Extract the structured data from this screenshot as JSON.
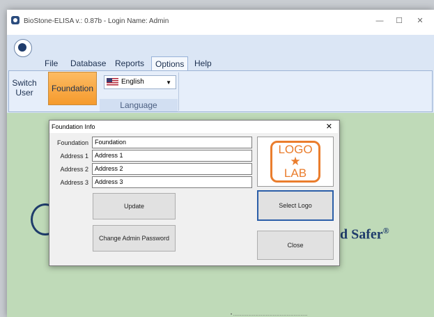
{
  "window": {
    "title": "BioStone-ELISA v.: 0.87b - Login Name: Admin",
    "controls": {
      "minimize": "—",
      "maximize": "☐",
      "close": "✕"
    }
  },
  "ribbon": {
    "tabs": [
      "File",
      "Database",
      "Reports",
      "Options",
      "Help"
    ],
    "active_tab": "Options",
    "buttons": {
      "switch_user": "Switch User",
      "foundation": "Foundation"
    },
    "language": {
      "selected": "English",
      "group_label": "Language"
    }
  },
  "main": {
    "tagline": "d Safer",
    "tagline_mark": "®",
    "bottom_text": "• ................................................................"
  },
  "dialog": {
    "title": "Foundation Info",
    "close": "✕",
    "fields": [
      {
        "label": "Foundation",
        "value": "Foundation"
      },
      {
        "label": "Address 1",
        "value": "Address 1"
      },
      {
        "label": "Address 2",
        "value": "Address 2"
      },
      {
        "label": "Address 3",
        "value": "Address 3"
      }
    ],
    "buttons": {
      "update": "Update",
      "change_password": "Change Admin Password",
      "select_logo": "Select Logo",
      "close": "Close"
    },
    "logo": {
      "line1": "LOGO",
      "star": "★",
      "line2": "LAB"
    }
  },
  "colors": {
    "accent_orange": "#f59a2c",
    "ribbon_blue": "#dbe6f5",
    "main_green": "#bfdab8",
    "logo_orange": "#ea7d2d",
    "brand_navy": "#1f3c6b"
  }
}
